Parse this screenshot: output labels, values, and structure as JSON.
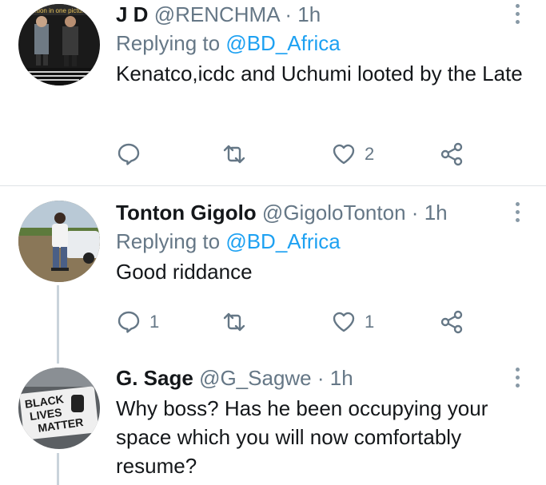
{
  "tweets": [
    {
      "name": "J D",
      "handle": "@RENCHMA",
      "separator": "·",
      "time": "1h",
      "replying_prefix": "Replying to",
      "replying_to": "@BD_Africa",
      "text": "Kenatco,icdc and Uchumi looted by the Late",
      "avatar_caption": "...tion in one pictu...",
      "reply_count": "",
      "retweet_count": "",
      "like_count": "2"
    },
    {
      "name": "Tonton Gigolo",
      "handle": "@GigoloTonton",
      "separator": "·",
      "time": "1h",
      "replying_prefix": "Replying to",
      "replying_to": "@BD_Africa",
      "text": "Good riddance",
      "reply_count": "1",
      "retweet_count": "",
      "like_count": "1"
    },
    {
      "name": "G. Sage",
      "handle": "@G_Sagwe",
      "separator": "·",
      "time": "1h",
      "text": "Why boss? Has he been occupying your space which you will now comfortably resume?",
      "avatar_sign": [
        "BLACK",
        "LIVES",
        "MATTER"
      ]
    }
  ],
  "icons": {
    "reply": "reply-icon",
    "retweet": "retweet-icon",
    "like": "heart-icon",
    "share": "share-icon",
    "more": "more-vertical-icon"
  },
  "colors": {
    "link": "#1da1f2",
    "secondary_text": "#657786",
    "primary_text": "#14171a",
    "divider": "#dfe3e6"
  }
}
